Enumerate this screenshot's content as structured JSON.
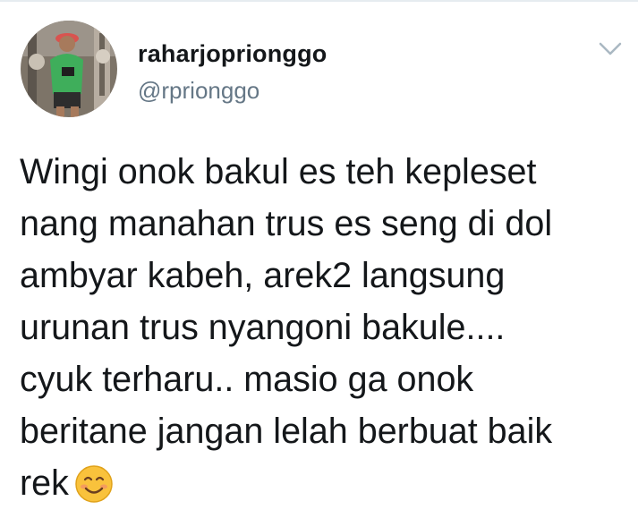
{
  "tweet": {
    "author": {
      "display_name": "raharjoprionggo",
      "handle": "@rprionggo",
      "avatar_icon": "profile-photo"
    },
    "menu_icon": "chevron-down-icon",
    "text_lines": [
      "Wingi onok bakul es teh kepleset",
      "nang manahan trus es seng di dol",
      "ambyar kabeh, arek2 langsung",
      "urunan trus nyangoni bakule....",
      "cyuk terharu.. masio ga onok",
      "beritane jangan lelah berbuat baik",
      "rek"
    ],
    "trailing_emoji": "smiling-face-emoji"
  },
  "colors": {
    "text": "#14171a",
    "secondary_text": "#657786",
    "caret": "#aab8c2",
    "emoji_face": "#f9c23c"
  }
}
